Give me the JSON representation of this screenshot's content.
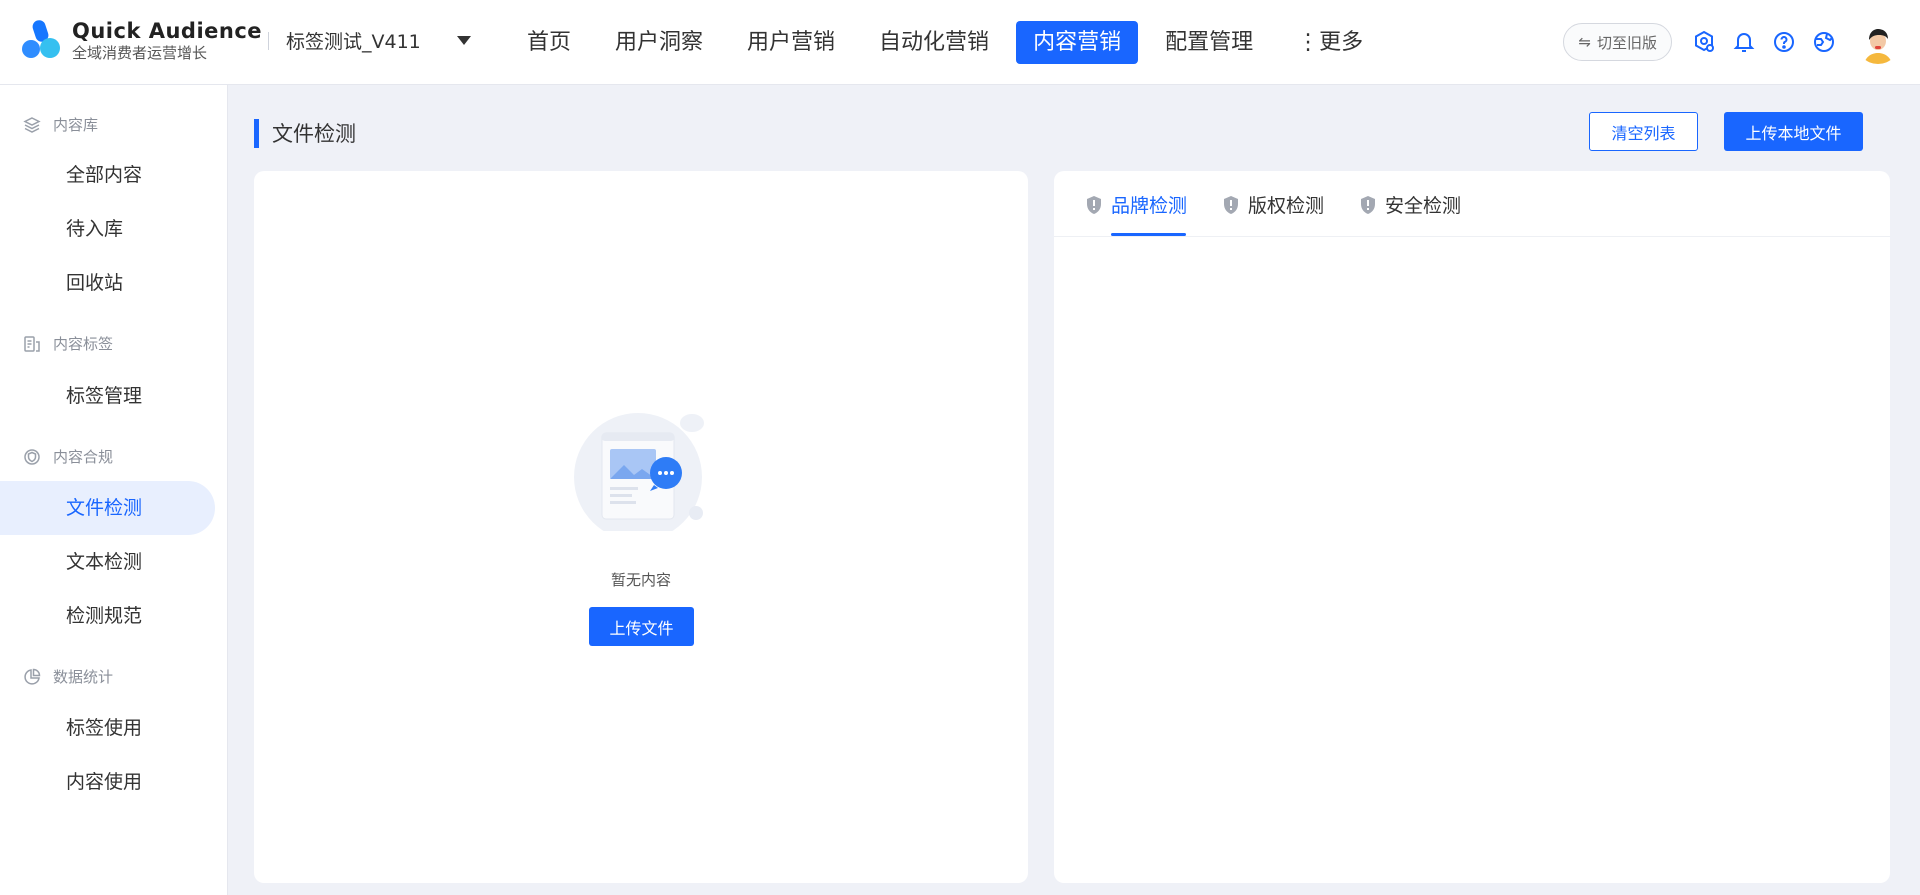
{
  "app": {
    "title": "Quick Audience",
    "subtitle": "全域消费者运营增长"
  },
  "workspace": {
    "name": "标签测试_V411"
  },
  "nav": {
    "items": [
      {
        "label": "首页"
      },
      {
        "label": "用户洞察"
      },
      {
        "label": "用户营销"
      },
      {
        "label": "自动化营销"
      },
      {
        "label": "内容营销",
        "active": true
      },
      {
        "label": "配置管理"
      },
      {
        "label": "⋮更多"
      }
    ]
  },
  "header_right": {
    "switch_label": "切至旧版",
    "switch_icon": "switch-arrows-icon"
  },
  "sidebar": {
    "groups": [
      {
        "label": "内容库",
        "icon": "layers-icon",
        "items": [
          {
            "label": "全部内容"
          },
          {
            "label": "待入库"
          },
          {
            "label": "回收站"
          }
        ]
      },
      {
        "label": "内容标签",
        "icon": "tag-list-icon",
        "items": [
          {
            "label": "标签管理"
          }
        ]
      },
      {
        "label": "内容合规",
        "icon": "shield-check-icon",
        "items": [
          {
            "label": "文件检测",
            "active": true
          },
          {
            "label": "文本检测"
          },
          {
            "label": "检测规范"
          }
        ]
      },
      {
        "label": "数据统计",
        "icon": "pie-chart-icon",
        "items": [
          {
            "label": "标签使用"
          },
          {
            "label": "内容使用"
          }
        ]
      }
    ]
  },
  "page": {
    "title": "文件检测",
    "clear_button": "清空列表",
    "upload_local_button": "上传本地文件"
  },
  "left_panel": {
    "empty_text": "暂无内容",
    "upload_button": "上传文件"
  },
  "right_panel": {
    "tabs": [
      {
        "label": "品牌检测",
        "active": true
      },
      {
        "label": "版权检测"
      },
      {
        "label": "安全检测"
      }
    ]
  },
  "colors": {
    "accent": "#1966ff",
    "background": "#eff1f7"
  }
}
